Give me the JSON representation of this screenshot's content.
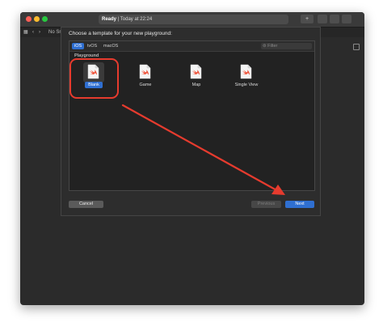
{
  "titlebar": {
    "status_bold": "Ready",
    "status_rest": " | Today at 22:24",
    "add_label": "+"
  },
  "toolbar": {
    "scheme_label": "No Sn"
  },
  "dialog": {
    "title": "Choose a template for your new playground:",
    "tabs": [
      {
        "label": "iOS",
        "selected": true
      },
      {
        "label": "tvOS",
        "selected": false
      },
      {
        "label": "macOS",
        "selected": false
      }
    ],
    "filter_placeholder": "Filter",
    "section": "Playground",
    "templates": [
      {
        "label": "Blank",
        "selected": true,
        "icon": "swift-file-icon"
      },
      {
        "label": "Game",
        "selected": false,
        "icon": "swift-file-icon"
      },
      {
        "label": "Map",
        "selected": false,
        "icon": "swift-file-icon"
      },
      {
        "label": "Single View",
        "selected": false,
        "icon": "swift-file-icon"
      }
    ],
    "cancel_label": "Cancel",
    "previous_label": "Previous",
    "next_label": "Next"
  },
  "colors": {
    "accent": "#2f6fd1",
    "annotation": "#e63b2e",
    "swift_orange": "#f05138"
  }
}
